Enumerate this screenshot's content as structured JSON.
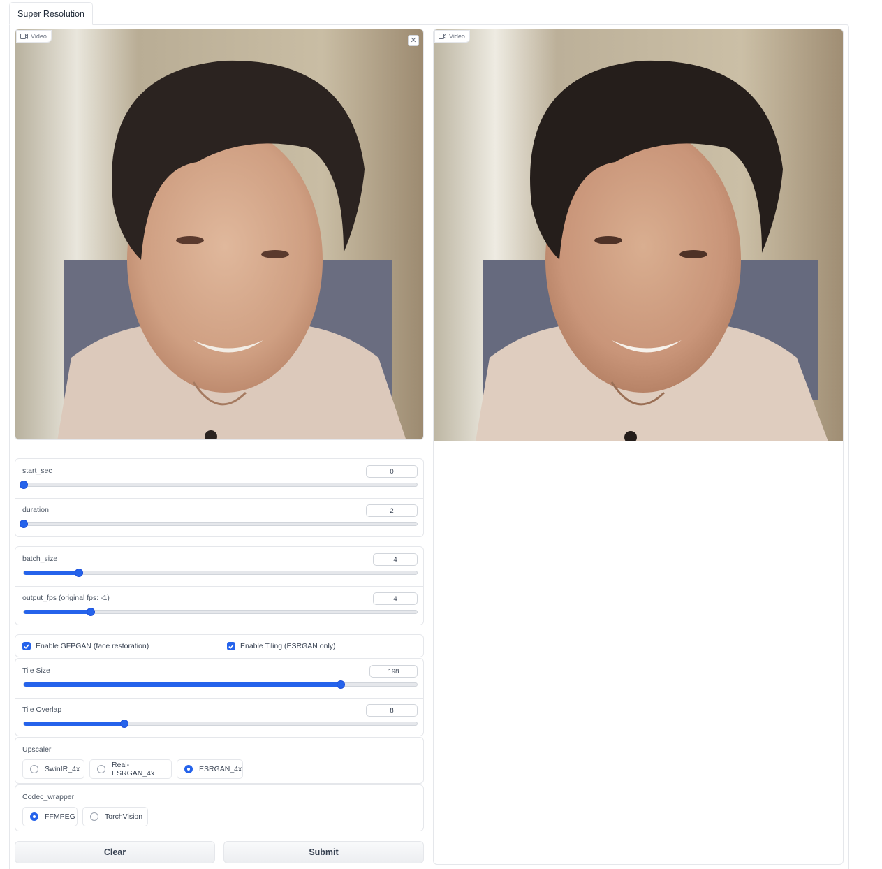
{
  "tabs": {
    "active": "Super Resolution"
  },
  "input_video": {
    "label": "Video",
    "close_symbol": "✕"
  },
  "output_video": {
    "label": "Video"
  },
  "sliders": {
    "start_sec": {
      "label": "start_sec",
      "value": "0",
      "fraction": 0.0
    },
    "duration": {
      "label": "duration",
      "value": "2",
      "fraction": 0.0
    },
    "batch_size": {
      "label": "batch_size",
      "value": "4",
      "fraction": 0.14
    },
    "output_fps": {
      "label": "output_fps (original fps: -1)",
      "value": "4",
      "fraction": 0.17
    },
    "tile_size": {
      "label": "Tile Size",
      "value": "198",
      "fraction": 0.806
    },
    "tile_overlap": {
      "label": "Tile Overlap",
      "value": "8",
      "fraction": 0.256
    }
  },
  "checkboxes": {
    "gfpgan": {
      "label": "Enable GFPGAN (face restoration)",
      "checked": true
    },
    "tiling": {
      "label": "Enable Tiling (ESRGAN only)",
      "checked": true
    }
  },
  "upscaler": {
    "title": "Upscaler",
    "options": [
      "SwinIR_4x",
      "Real-ESRGAN_4x",
      "ESRGAN_4x"
    ],
    "selected": "ESRGAN_4x"
  },
  "codec": {
    "title": "Codec_wrapper",
    "options": [
      "FFMPEG",
      "TorchVision"
    ],
    "selected": "FFMPEG"
  },
  "buttons": {
    "clear": "Clear",
    "submit": "Submit"
  },
  "colors": {
    "accent": "#2563eb",
    "border": "#e5e7eb"
  }
}
